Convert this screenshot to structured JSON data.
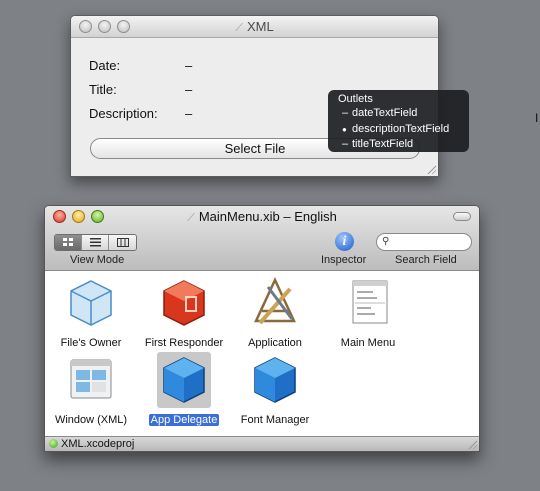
{
  "xml_window": {
    "title": "XML",
    "fields": [
      {
        "label": "Date:",
        "value": "–"
      },
      {
        "label": "Title:",
        "value": "–"
      },
      {
        "label": "Description:",
        "value": "–"
      }
    ],
    "select_button": "Select File"
  },
  "outlets_popup": {
    "title": "Outlets",
    "items": [
      {
        "mark": "–",
        "name": "dateTextField"
      },
      {
        "mark": "●",
        "name": "descriptionTextField"
      },
      {
        "mark": "–",
        "name": "titleTextField"
      }
    ]
  },
  "xib_window": {
    "title": "MainMenu.xib – English",
    "toolbar": {
      "view_mode_label": "View Mode",
      "inspector_label": "Inspector",
      "search_label": "Search Field"
    },
    "objects": [
      {
        "label": "File's Owner",
        "icon": "files-owner-cube-icon"
      },
      {
        "label": "First Responder",
        "icon": "first-responder-icon"
      },
      {
        "label": "Application",
        "icon": "application-icon"
      },
      {
        "label": "Main Menu",
        "icon": "main-menu-icon"
      },
      {
        "label": "Window (XML)",
        "icon": "window-icon"
      },
      {
        "label": "App Delegate",
        "icon": "blue-cube-icon",
        "selected": true
      },
      {
        "label": "Font Manager",
        "icon": "blue-cube-icon"
      }
    ],
    "status": "XML.xcodeproj"
  },
  "colors": {
    "desktop": "#7e8186",
    "selection": "#3b6ed6",
    "popup_bg": "#1c1e22"
  }
}
